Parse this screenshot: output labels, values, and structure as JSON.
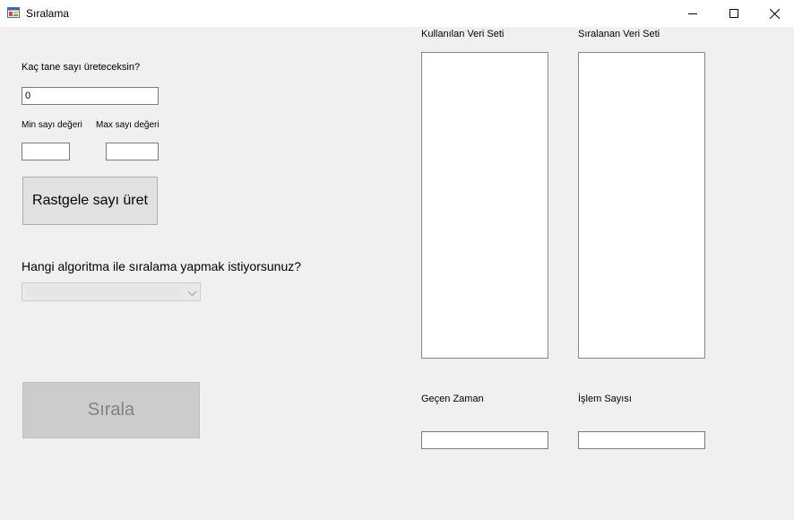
{
  "window": {
    "title": "Sıralama"
  },
  "left": {
    "count_label": "Kaç tane sayı üreteceksin?",
    "count_value": "0",
    "min_label": "Min sayı değeri",
    "max_label": "Max sayı değeri",
    "min_value": "",
    "max_value": "",
    "generate_button": "Rastgele sayı üret",
    "algorithm_question": "Hangi algoritma ile sıralama yapmak istiyorsunuz?",
    "algorithm_selected": "",
    "sort_button": "Sırala"
  },
  "right": {
    "used_dataset_label": "Kullanılan Veri Seti",
    "sorted_dataset_label": "Sıralanan Veri Seti",
    "elapsed_time_label": "Geçen Zaman",
    "operation_count_label": "İşlem Sayısı",
    "elapsed_time_value": "",
    "operation_count_value": ""
  },
  "icons": {
    "app": "app-window-icon",
    "minimize": "minimize-icon",
    "maximize": "maximize-icon",
    "close": "close-icon",
    "dropdown": "chevron-down-icon"
  }
}
